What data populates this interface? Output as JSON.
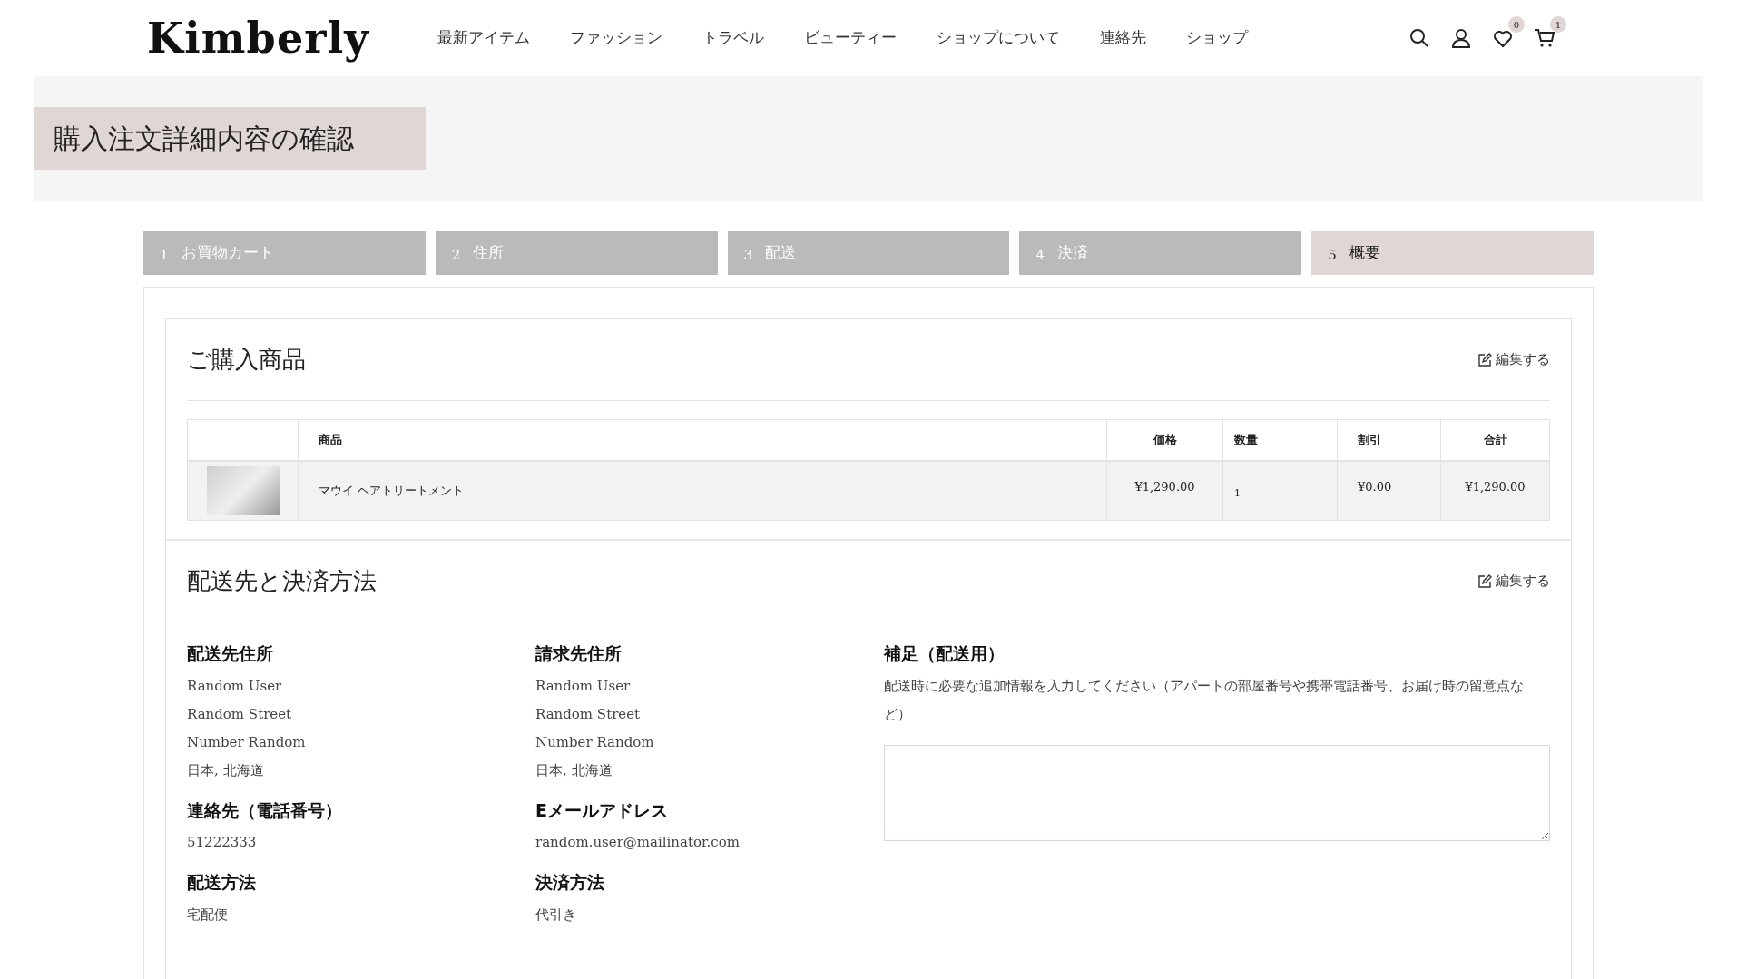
{
  "header": {
    "logo": "Kimberly",
    "nav": [
      {
        "label": "最新アイテム"
      },
      {
        "label": "ファッション"
      },
      {
        "label": "トラベル"
      },
      {
        "label": "ビューティー"
      },
      {
        "label": "ショップについて"
      },
      {
        "label": "連絡先"
      },
      {
        "label": "ショップ"
      }
    ],
    "icons": [
      {
        "kind": "search"
      },
      {
        "kind": "account"
      },
      {
        "kind": "wishlist",
        "badge": "0"
      },
      {
        "kind": "cart",
        "badge": "1"
      }
    ]
  },
  "page_title": "購入注文詳細内容の確認",
  "steps": [
    {
      "number": "1",
      "label": "お買物カート",
      "selected": false
    },
    {
      "number": "2",
      "label": "住所",
      "selected": false
    },
    {
      "number": "3",
      "label": "配送",
      "selected": false
    },
    {
      "number": "4",
      "label": "決済",
      "selected": false
    },
    {
      "number": "5",
      "label": "概要",
      "selected": true
    }
  ],
  "products_section": {
    "title": "ご購入商品",
    "edit": "編集する",
    "table": {
      "columns": [
        "商品",
        "価格",
        "数量",
        "割引",
        "合計"
      ],
      "rows": [
        {
          "product": "マウイ ヘアトリートメント",
          "price": "¥1,290.00",
          "quantity": "1",
          "discount": "¥0.00",
          "total": "¥1,290.00"
        }
      ]
    }
  },
  "shipping_section": {
    "title": "配送先と決済方法",
    "edit": "編集する",
    "columns": [
      [
        {
          "heading": "配送先住所",
          "lines": [
            "Random User",
            "Random Street",
            "Number Random",
            "日本, 北海道"
          ]
        },
        {
          "heading": "連絡先（電話番号）",
          "lines": [
            "51222333"
          ]
        },
        {
          "heading": "配送方法",
          "lines": [
            "宅配便"
          ]
        }
      ],
      [
        {
          "heading": "請求先住所",
          "lines": [
            "Random User",
            "Random Street",
            "Number Random",
            "日本, 北海道"
          ]
        },
        {
          "heading": "Eメールアドレス",
          "lines": [
            "random.user@mailinator.com"
          ]
        },
        {
          "heading": "決済方法",
          "lines": [
            "代引き"
          ]
        }
      ]
    ],
    "note": {
      "heading": "補足（配送用）",
      "description": "配送時に必要な追加情報を入力してください（アパートの部屋番号や携帯電話番号、お届け時の留意点など）"
    }
  }
}
